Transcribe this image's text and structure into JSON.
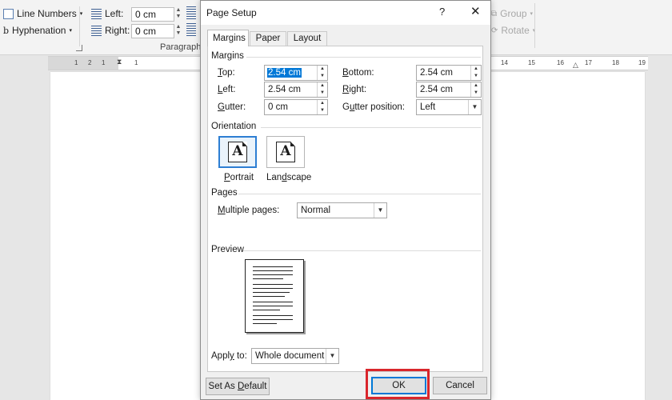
{
  "ribbon": {
    "line_numbers": "Line Numbers",
    "hyphenation": "Hyphenation",
    "indent_left_label": "Left:",
    "indent_left_value": "0 cm",
    "indent_right_label": "Right:",
    "indent_right_value": "0 cm",
    "paragraph_group": "Paragraph",
    "group": "Group",
    "rotate": "Rotate"
  },
  "ruler": {
    "left_ticks": [
      "1",
      "2",
      "1",
      "1"
    ],
    "right_ticks": [
      "14",
      "15",
      "16",
      "17",
      "18",
      "19"
    ]
  },
  "dialog": {
    "title": "Page Setup",
    "help": "?",
    "close": "✕",
    "tabs": [
      "Margins",
      "Paper",
      "Layout"
    ],
    "margins_section": "Margins",
    "top_label_u": "T",
    "top_label_rest": "op:",
    "top_value": "2.54 cm",
    "bottom_label_u": "B",
    "bottom_label_rest": "ottom:",
    "bottom_value": "2.54 cm",
    "left_label_u": "L",
    "left_label_rest": "eft:",
    "left_value": "2.54 cm",
    "right_label_u": "R",
    "right_label_rest": "ight:",
    "right_value": "2.54 cm",
    "gutter_label_u": "G",
    "gutter_label_rest": "utter:",
    "gutter_value": "0 cm",
    "gutter_pos_label_pre": "G",
    "gutter_pos_label_u": "u",
    "gutter_pos_label_rest": "tter position:",
    "gutter_pos_value": "Left",
    "orientation_section": "Orientation",
    "portrait_u": "P",
    "portrait_rest": "ortrait",
    "landscape_pre": "Lan",
    "landscape_u": "d",
    "landscape_rest": "scape",
    "orientation_glyph": "A",
    "pages_section": "Pages",
    "multiple_pages_u": "M",
    "multiple_pages_rest": "ultiple pages:",
    "multiple_pages_value": "Normal",
    "preview_section": "Preview",
    "apply_to_pre": "Appl",
    "apply_to_u": "y",
    "apply_to_rest": " to:",
    "apply_to_value": "Whole document",
    "set_default_pre": "Set As ",
    "set_default_u": "D",
    "set_default_rest": "efault",
    "ok": "OK",
    "cancel": "Cancel"
  },
  "colors": {
    "selection_blue": "#0078d7",
    "highlight_red": "#d9262c"
  }
}
